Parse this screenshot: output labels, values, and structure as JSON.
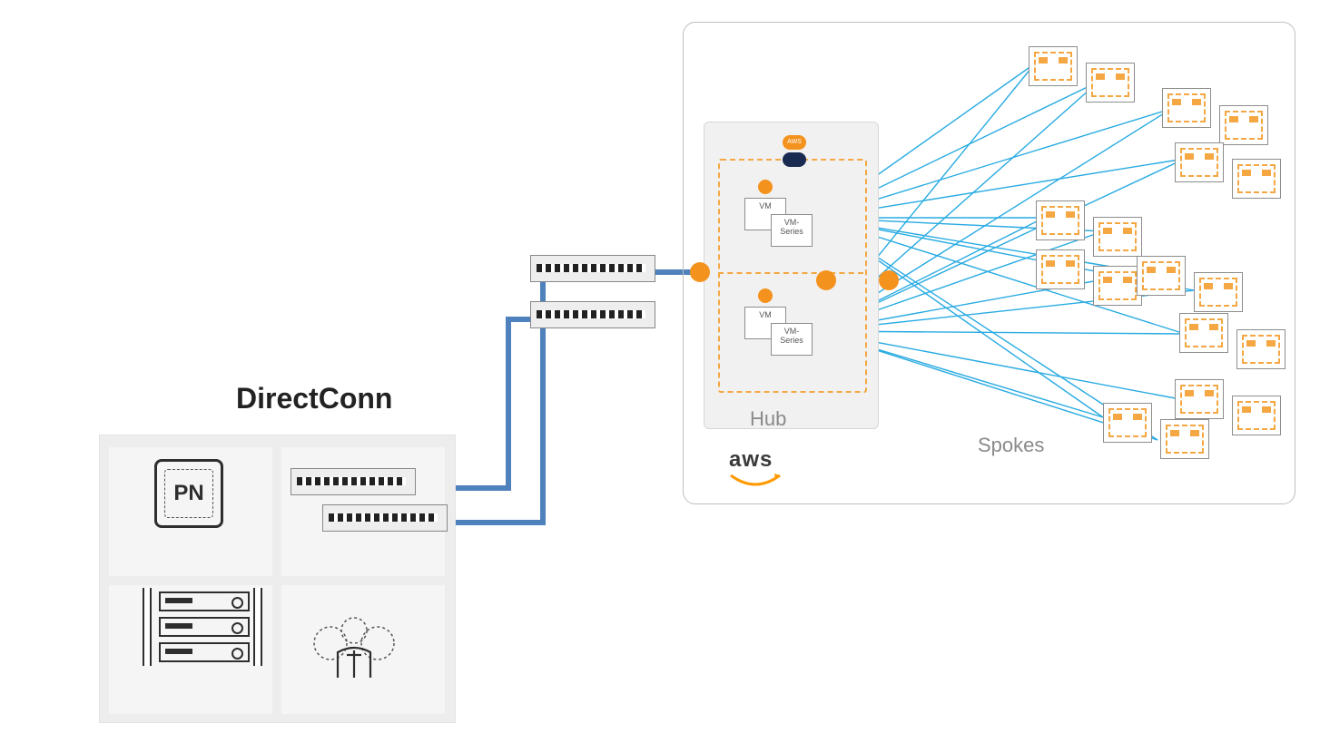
{
  "title_onprem": "DirectConn",
  "onprem": {
    "pn_label": "PN",
    "quadrants": [
      "panorama",
      "switches",
      "servers",
      "users"
    ]
  },
  "aws": {
    "logo_text": "aws",
    "hub_label": "Hub",
    "spokes_label": "Spokes",
    "vm_label_short": "VM",
    "vm_label_long": "VM-\nSeries",
    "cloud_badge": "AWS"
  },
  "diagram": {
    "spoke_pairs": 8,
    "hub_vm_groups": 2,
    "dc_switch_count_top": 2,
    "dc_switch_count_onprem": 2
  },
  "colors": {
    "connection_thick": "#4f81bd",
    "connection_thin": "#29abe2",
    "accent": "#f4a742",
    "orange": "#f4921e"
  }
}
